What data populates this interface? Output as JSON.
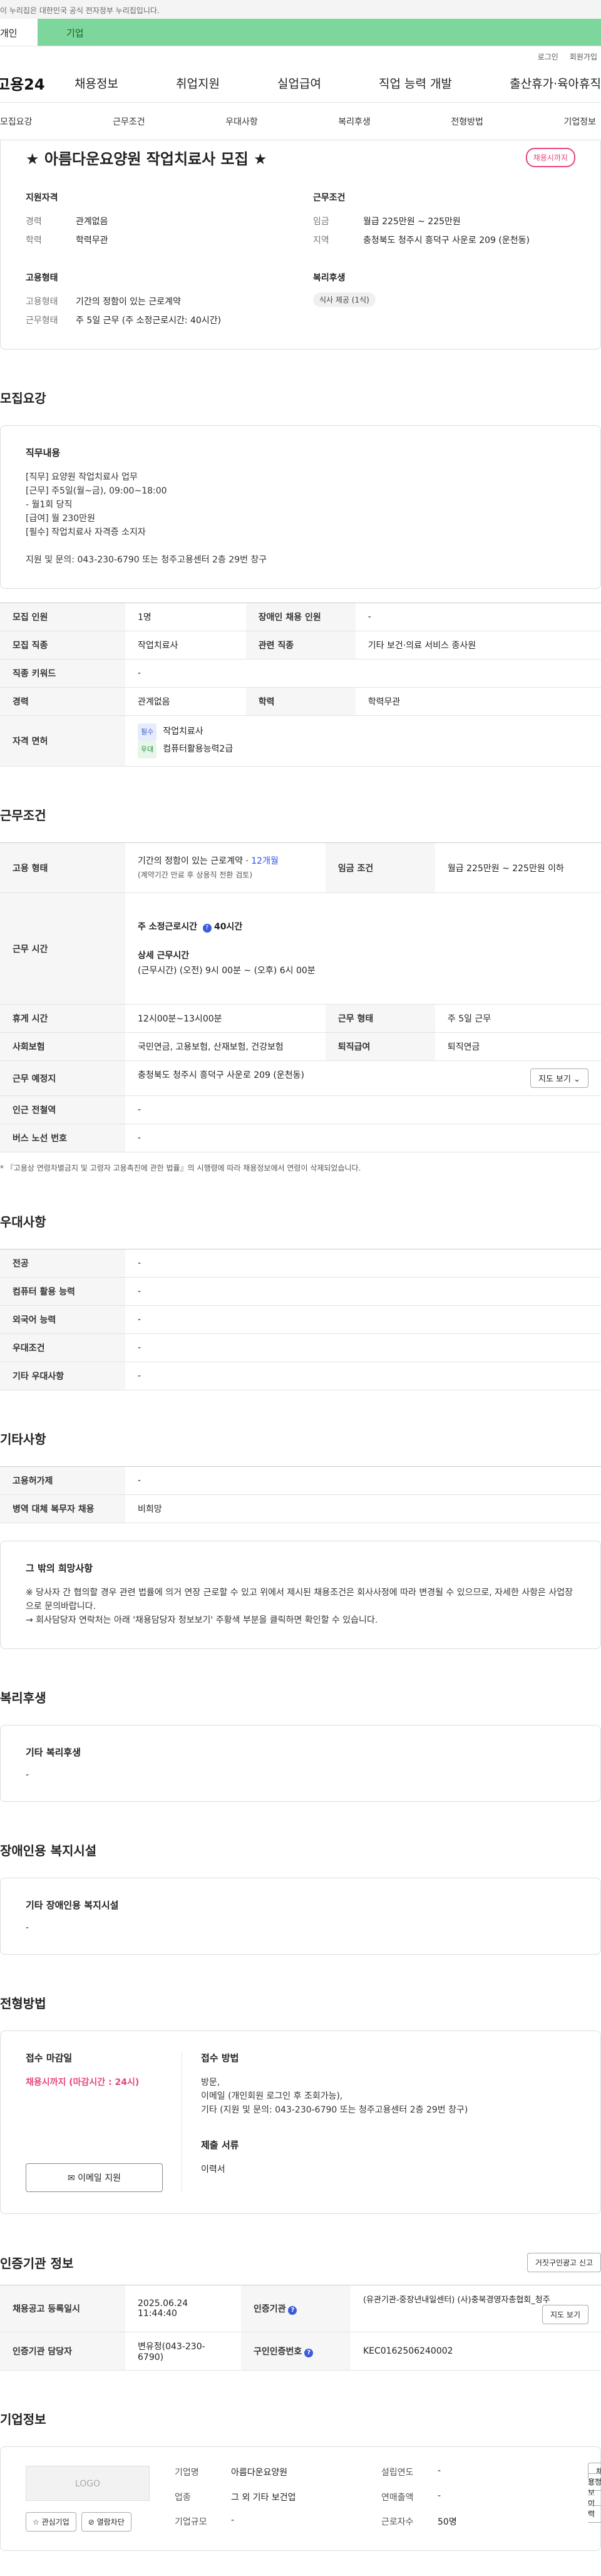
{
  "topbar": {
    "notice": "이 누리집은 대한민국 공식 전자정부 누리집입니다."
  },
  "tabs": {
    "personal": "개인",
    "company": "기업"
  },
  "utility": {
    "login": "로그인",
    "join": "회원가입"
  },
  "gnb": {
    "logo": "고용24",
    "menu": [
      "채용정보",
      "취업지원",
      "실업급여",
      "직업 능력 개발",
      "출산휴가·육아휴직"
    ]
  },
  "anchors": [
    "모집요강",
    "근무조건",
    "우대사항",
    "복리후생",
    "전형방법",
    "기업정보"
  ],
  "title": "★ 아름다운요양원 작업치료사 모집 ★",
  "status_badge": "채용시까지",
  "summary": {
    "qualification": {
      "head": "지원자격",
      "career_k": "경력",
      "career_v": "관계없음",
      "edu_k": "학력",
      "edu_v": "학력무관"
    },
    "condition": {
      "head": "근무조건",
      "wage_k": "임금",
      "wage_v": "월급 225만원 ~ 225만원",
      "loc_k": "지역",
      "loc_v": "충청북도 청주시 흥덕구 사운로 209 (운천동)"
    },
    "employment": {
      "head": "고용형태",
      "type_k": "고용형태",
      "type_v": "기간의 정함이 있는 근로계약",
      "hours_k": "근무형태",
      "hours_v": "주 5일 근무 (주 소정근로시간: 40시간)"
    },
    "welfare": {
      "head": "복리후생",
      "pill": "식사 제공 (1식)"
    }
  },
  "recruit": {
    "section": "모집요강",
    "duty_head": "직무내용",
    "duty_text": "[직무] 요양원 작업치료사 업무\n[근무] 주5일(월~금), 09:00~18:00\n   - 월1회 당직\n[급여] 월 230만원\n[필수] 작업치료사 자격증 소지자\n\n지원 및 문의: 043-230-6790 또는 청주고용센터 2층 29번 창구",
    "rows": {
      "count_k": "모집 인원",
      "count_v": "1명",
      "disabled_k": "장애인 채용 인원",
      "disabled_v": "-",
      "job_k": "모집 직종",
      "job_v": "작업치료사",
      "related_k": "관련 직종",
      "related_v": "기타 보건·의료 서비스 종사원",
      "keyword_k": "직종 키워드",
      "keyword_v": "-",
      "career_k": "경력",
      "career_v": "관계없음",
      "edu_k": "학력",
      "edu_v": "학력무관",
      "license_k": "자격 면허",
      "license_req_tag": "필수",
      "license_req": "작업치료사",
      "license_pref_tag": "우대",
      "license_pref": "컴퓨터활용능력2급"
    }
  },
  "work": {
    "section": "근무조건",
    "emp_k": "고용 형태",
    "emp_v1": "기간의 정함이 있는 근로계약 · ",
    "emp_months": "12개월",
    "emp_v2": "(계약기간 만료 후 상용직 전환 검토)",
    "wage_k": "임금 조건",
    "wage_v": "월급 225만원 ~ 225만원 이하",
    "time_k": "근무 시간",
    "time_weekly_label": "주 소정근로시간",
    "time_weekly_val": "40시간",
    "time_detail_label": "상세 근무시간",
    "time_detail_val": "(근무시간) (오전) 9시 00분 ~ (오후) 6시 00분",
    "rest_k": "휴게 시간",
    "rest_v": "12시00분~13시00분",
    "form_k": "근무 형태",
    "form_v": "주 5일 근무",
    "ins_k": "사회보험",
    "ins_v": "국민연금, 고용보험, 산재보험, 건강보험",
    "ret_k": "퇴직급여",
    "ret_v": "퇴직연금",
    "place_k": "근무 예정지",
    "place_v": "충청북도 청주시 흥덕구 사운로 209 (운천동)",
    "map_btn": "지도 보기 ⌄",
    "station_k": "인근 전철역",
    "station_v": "-",
    "bus_k": "버스 노선 번호",
    "bus_v": "-",
    "note": "* 『고용상 연령차별금지 및 고령자 고용촉진에 관한 법률』의 시행령에 따라 채용정보에서 연령이 삭제되었습니다."
  },
  "pref": {
    "section": "우대사항",
    "rows": [
      {
        "k": "전공",
        "v": "-"
      },
      {
        "k": "컴퓨터 활용 능력",
        "v": "-"
      },
      {
        "k": "외국어 능력",
        "v": "-"
      },
      {
        "k": "우대조건",
        "v": "-"
      },
      {
        "k": "기타 우대사항",
        "v": "-"
      }
    ]
  },
  "etc": {
    "section": "기타사항",
    "hire_k": "고용허가제",
    "hire_v": "-",
    "mil_k": "병역 대체 복무자 채용",
    "mil_v": "비희망",
    "box_head": "그 밖의 희망사항",
    "box_text": "※ 당사자 간 협의할 경우 관련 법률에 의거 연장 근로할 수 있고 위에서 제시된 채용조건은 회사사정에 따라 변경될 수 있으므로, 자세한 사항은 사업장으로 문의바랍니다.\n→ 회사담당자 연락처는 아래 '채용담당자 정보보기' 주황색 부분을 클릭하면 확인할 수 있습니다."
  },
  "welfare": {
    "section": "복리후생",
    "head": "기타 복리후생",
    "value": "-"
  },
  "facility": {
    "section": "장애인용 복지시설",
    "head": "기타 장애인용 복지시설",
    "value": "-"
  },
  "process": {
    "section": "전형방법",
    "deadline_head": "접수 마감일",
    "deadline_val": "채용시까지 (마감시간 : 24시)",
    "email_btn": "✉ 이메일 지원",
    "method_head": "접수 방법",
    "method_text": "방문,\n이메일 (개인회원 로그인 후 조회가능),\n기타 (지원 및 문의: 043-230-6790 또는 청주고용센터 2층 29번 창구)",
    "docs_head": "제출 서류",
    "docs_val": "이력서"
  },
  "cert": {
    "section": "인증기관 정보",
    "report_btn": "거짓구인광고 신고",
    "reg_k": "채용공고 등록일시",
    "reg_v": "2025.06.24 11:44:40",
    "org_k": "인증기관",
    "org_v": "(유관기관-중장년내일센터) (사)충북경영자총협회_청주",
    "map_btn": "지도 보기",
    "mgr_k": "인증기관 담당자",
    "mgr_v": "변유정(043-230-6790)",
    "no_k": "구인인증번호",
    "no_v": "KEC0162506240002"
  },
  "company": {
    "section": "기업정보",
    "logo": "LOGO",
    "interest_btn": "☆ 관심기업",
    "block_btn": "⊘ 열람차단",
    "name_k": "기업명",
    "name_v": "아름다운요양원",
    "year_k": "설립연도",
    "year_v": "-",
    "ind_k": "업종",
    "ind_v": "그 외 기타 보건업",
    "sales_k": "연매출액",
    "sales_v": "-",
    "size_k": "기업규모",
    "size_v": "-",
    "emp_k": "근로자수",
    "emp_v": "50명",
    "history_btn": "채용정보 이력"
  }
}
